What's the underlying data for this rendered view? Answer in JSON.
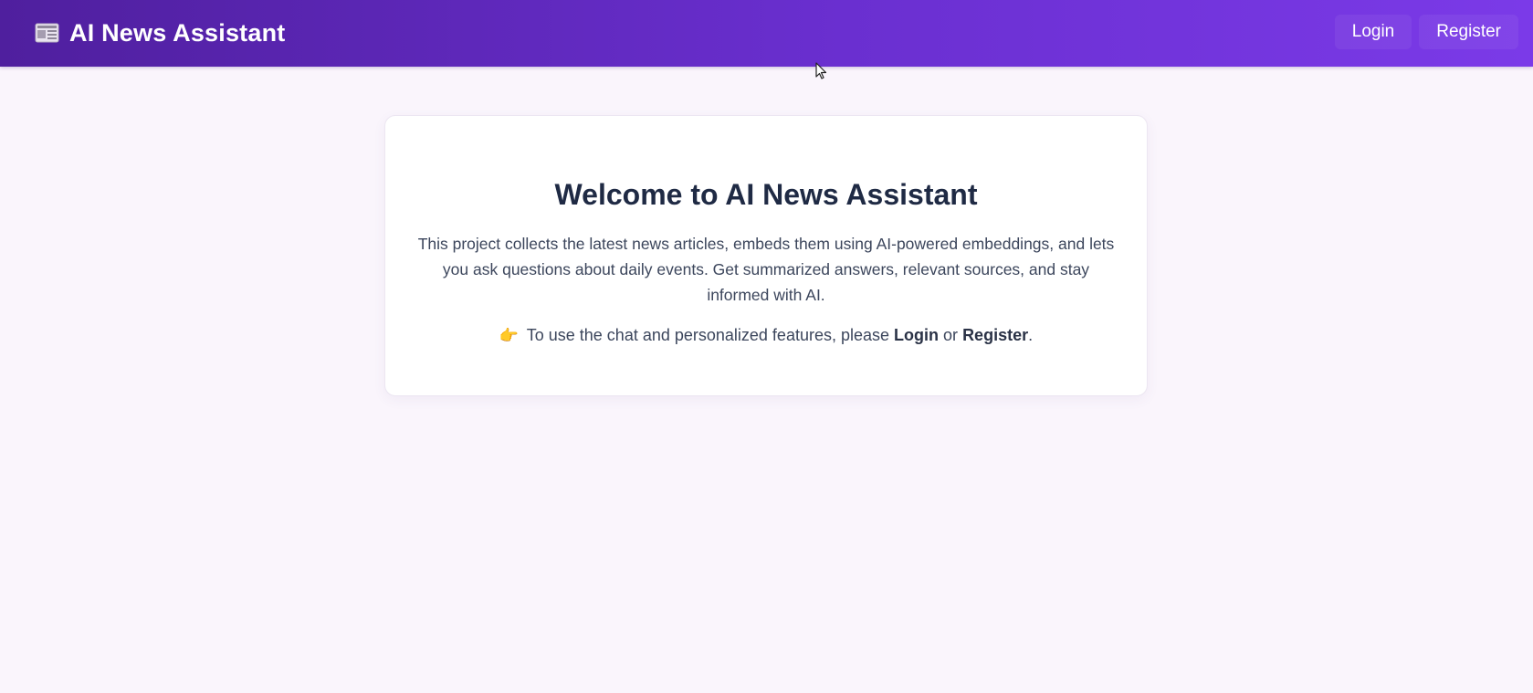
{
  "navbar": {
    "brand_icon": "newspaper-icon",
    "brand_title": "AI News Assistant",
    "login_label": "Login",
    "register_label": "Register"
  },
  "welcome": {
    "title": "Welcome to AI News Assistant",
    "description": "This project collects the latest news articles, embeds them using AI-powered embeddings, and lets you ask questions about daily events. Get summarized answers, relevant sources, and stay informed with AI.",
    "cta_emoji": "👉",
    "cta_prefix": "To use the chat and personalized features, please",
    "cta_login": "Login",
    "cta_or": "or",
    "cta_register": "Register",
    "cta_suffix": "."
  },
  "colors": {
    "navbar_gradient_start": "#4f1f9e",
    "navbar_gradient_end": "#7b3ae8",
    "page_background": "#faf5fc",
    "heading": "#1f2a44",
    "body_text": "#3c465c"
  }
}
